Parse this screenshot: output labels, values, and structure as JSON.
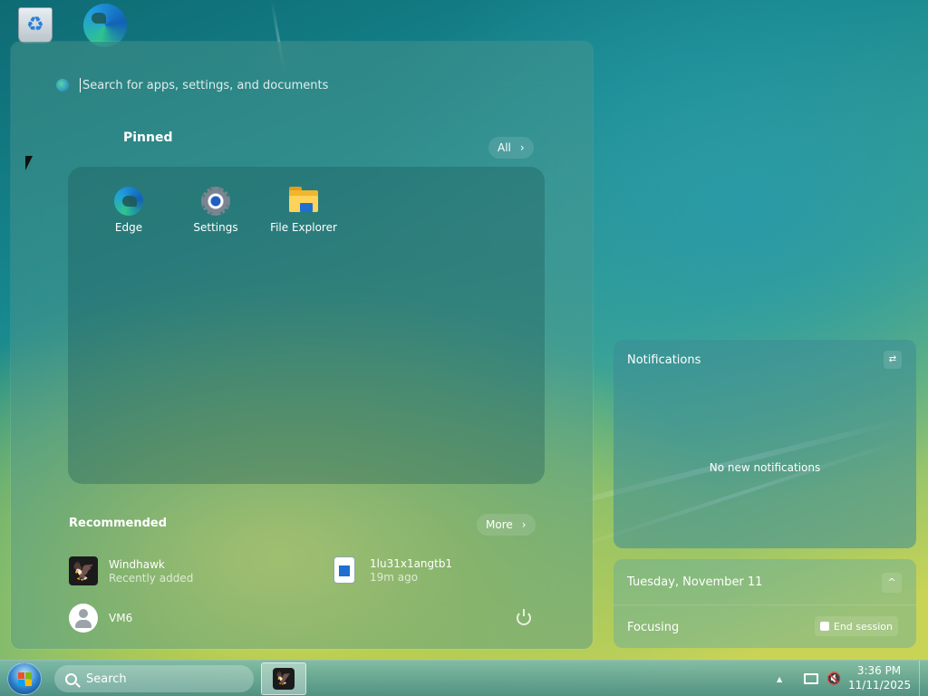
{
  "start_menu": {
    "search_placeholder": "Search for apps, settings, and documents",
    "pinned_title": "Pinned",
    "all_label": "All",
    "pinned_apps": [
      {
        "label": "Edge",
        "icon": "edge-icon"
      },
      {
        "label": "Settings",
        "icon": "gear-icon"
      },
      {
        "label": "File Explorer",
        "icon": "folder-icon"
      }
    ],
    "recommended_title": "Recommended",
    "more_label": "More",
    "recommended": [
      {
        "title": "Windhawk",
        "subtitle": "Recently added",
        "icon": "windhawk-icon"
      },
      {
        "title": "1lu31x1angtb1",
        "subtitle": "19m ago",
        "icon": "image-file-icon"
      }
    ],
    "user_name": "VM6"
  },
  "notifications": {
    "title": "Notifications",
    "empty_text": "No new notifications"
  },
  "calendar": {
    "date": "Tuesday, November 11",
    "focus_label": "Focusing",
    "end_session_label": "End session"
  },
  "taskbar": {
    "search_label": "Search",
    "time": "3:36 PM",
    "date": "11/11/2025"
  },
  "colors": {
    "accent": "#1f6fd0",
    "panel": "#4f968c"
  }
}
